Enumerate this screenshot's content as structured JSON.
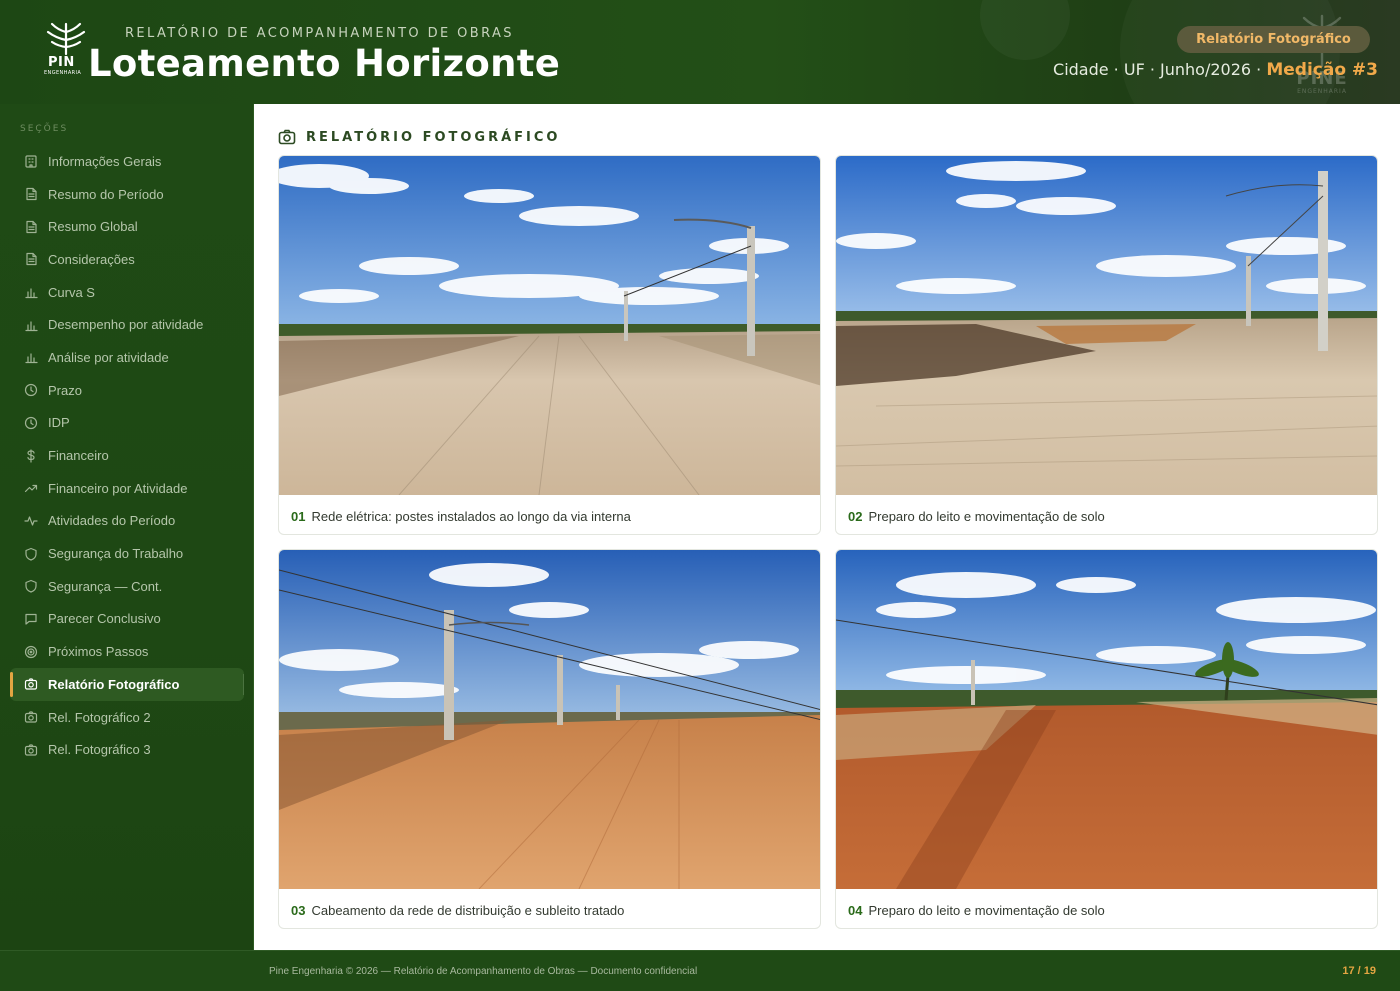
{
  "header": {
    "logo_text": "PIN",
    "logo_sub": "ENGENHARIA",
    "supertitle": "RELATÓRIO DE ACOMPANHAMENTO DE OBRAS",
    "title": "Loteamento Horizonte",
    "pill": "Relatório Fotográfico",
    "meta": "Cidade · UF · Junho/2026 · ",
    "medicao": "Medição #3",
    "watermark_text": "PINE",
    "watermark_sub": "ENGENHARIA"
  },
  "sidebar": {
    "title": "SEÇÕES",
    "items": [
      {
        "label": "Informações Gerais",
        "icon": "building-icon"
      },
      {
        "label": "Resumo do Período",
        "icon": "document-icon"
      },
      {
        "label": "Resumo Global",
        "icon": "document-icon"
      },
      {
        "label": "Considerações",
        "icon": "document-icon"
      },
      {
        "label": "Curva S",
        "icon": "bar-chart-icon"
      },
      {
        "label": "Desempenho por atividade",
        "icon": "bar-chart-icon"
      },
      {
        "label": "Análise por atividade",
        "icon": "bar-chart-icon"
      },
      {
        "label": "Prazo",
        "icon": "clock-icon"
      },
      {
        "label": "IDP",
        "icon": "clock-icon"
      },
      {
        "label": "Financeiro",
        "icon": "dollar-icon"
      },
      {
        "label": "Financeiro por Atividade",
        "icon": "trend-icon"
      },
      {
        "label": "Atividades do Período",
        "icon": "pulse-icon"
      },
      {
        "label": "Segurança do Trabalho",
        "icon": "shield-icon"
      },
      {
        "label": "Segurança — Cont.",
        "icon": "shield-icon"
      },
      {
        "label": "Parecer Conclusivo",
        "icon": "message-icon"
      },
      {
        "label": "Próximos Passos",
        "icon": "target-icon"
      },
      {
        "label": "Relatório Fotográfico",
        "icon": "camera-icon",
        "active": true
      },
      {
        "label": "Rel. Fotográfico 2",
        "icon": "camera-icon"
      },
      {
        "label": "Rel. Fotográfico 3",
        "icon": "camera-icon"
      }
    ]
  },
  "main": {
    "section_title": "RELATÓRIO FOTOGRÁFICO",
    "photos": [
      {
        "num": "01",
        "caption": "Rede elétrica: postes instalados ao longo da via interna"
      },
      {
        "num": "02",
        "caption": "Preparo do leito e movimentação de solo"
      },
      {
        "num": "03",
        "caption": "Cabeamento da rede de distribuição e subleito tratado"
      },
      {
        "num": "04",
        "caption": "Preparo do leito e movimentação de solo"
      }
    ]
  },
  "footer": {
    "text": "Pine Engenharia © 2026 — Relatório de Acompanhamento de Obras — Documento confidencial",
    "page": "17 / 19"
  },
  "colors": {
    "brand_green": "#1f4a15",
    "accent_orange": "#e3a542",
    "caption_number": "#2a6a1a"
  }
}
